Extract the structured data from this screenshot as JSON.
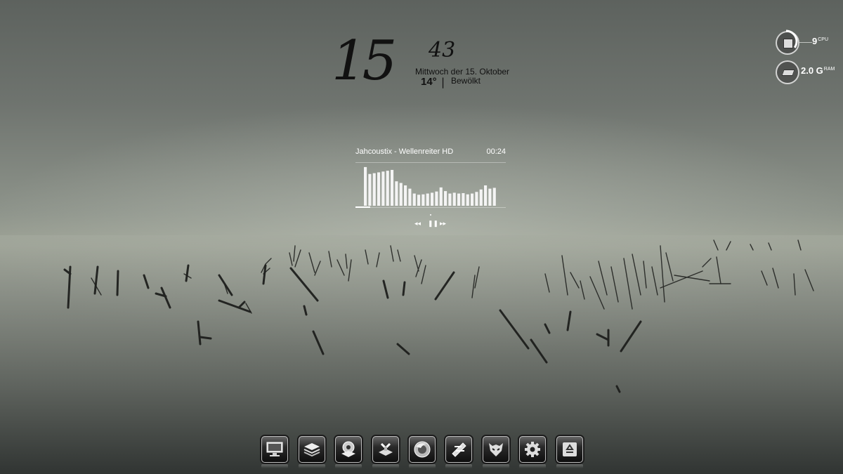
{
  "clock": {
    "hour": "15",
    "minute": "43",
    "date": "Mittwoch der 15. Oktober",
    "temperature": "14°",
    "separator": "|",
    "condition": "Bewölkt"
  },
  "system_monitor": {
    "cpu": {
      "value": "9",
      "unit": "CPU",
      "icon": "cpu-chip-icon"
    },
    "ram": {
      "value": "2.0 G",
      "unit": "RAM",
      "icon": "ram-icon"
    }
  },
  "player": {
    "track": "Jahcoustix - Wellenreiter HD",
    "elapsed": "00:24",
    "progress": 0.1,
    "visualizer_levels": [
      0.95,
      0.78,
      0.8,
      0.82,
      0.84,
      0.86,
      0.88,
      0.6,
      0.56,
      0.5,
      0.42,
      0.3,
      0.27,
      0.28,
      0.3,
      0.32,
      0.35,
      0.45,
      0.36,
      0.3,
      0.32,
      0.3,
      0.31,
      0.28,
      0.3,
      0.34,
      0.4,
      0.5,
      0.42,
      0.44
    ],
    "controls": {
      "previous": "◂◂",
      "pause": "❚❚",
      "next": "▸▸"
    }
  },
  "dock": {
    "items": [
      {
        "name": "computer",
        "icon": "monitor-icon"
      },
      {
        "name": "documents",
        "icon": "folder-stack-icon"
      },
      {
        "name": "media",
        "icon": "media-player-icon"
      },
      {
        "name": "network",
        "icon": "network-icon"
      },
      {
        "name": "firefox",
        "icon": "firefox-icon"
      },
      {
        "name": "editor",
        "icon": "edit-icon"
      },
      {
        "name": "game",
        "icon": "mask-icon"
      },
      {
        "name": "settings",
        "icon": "gear-icon"
      },
      {
        "name": "recycle-bin",
        "icon": "recycle-icon"
      }
    ]
  },
  "colors": {
    "clock_text": "#111111",
    "widget_text": "#ffffff",
    "dock_icon_bg": "#1a1a1a"
  }
}
